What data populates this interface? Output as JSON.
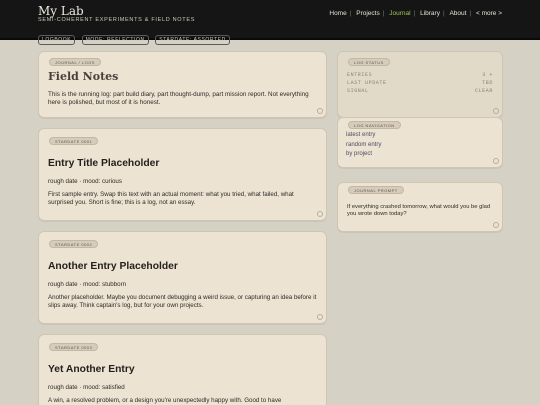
{
  "header": {
    "title": "My Lab",
    "subtitle": "SEMI-COHERENT EXPERIMENTS & FIELD NOTES",
    "nav": [
      "Home",
      "Projects",
      "Journal",
      "Library",
      "About",
      "< more >"
    ],
    "nav_active": "Journal",
    "chips": [
      "LOGBOOK",
      "MODE: REFLECTION",
      "STARDATE: ASSORTED"
    ]
  },
  "intro": {
    "label": "JOURNAL / LOGS",
    "title": "Field Notes",
    "text": "This is the running log: part build diary, part thought-dump, part mission report. Not everything here is polished, but most of it is honest."
  },
  "entries": [
    {
      "stardate": "STARDATE 0001",
      "title": "Entry Title Placeholder",
      "meta": "rough date · mood: curious",
      "body": "First sample entry. Swap this text with an actual moment: what you tried, what failed, what surprised you. Short is fine; this is a log, not an essay."
    },
    {
      "stardate": "STARDATE 0002",
      "title": "Another Entry Placeholder",
      "meta": "rough date · mood: stubborn",
      "body": "Another placeholder. Maybe you document debugging a weird issue, or capturing an idea before it slips away. Think captain's log, but for your own projects."
    },
    {
      "stardate": "STARDATE 0003",
      "title": "Yet Another Entry",
      "meta": "rough date · mood: satisfied",
      "body": "A win, a resolved problem, or a design you're unexpectedly happy with. Good to have"
    }
  ],
  "log_status": {
    "label": "LOG STATUS",
    "rows": [
      {
        "key": "ENTRIES",
        "value": "3 +"
      },
      {
        "key": "LAST UPDATE",
        "value": "TBD"
      },
      {
        "key": "SIGNAL",
        "value": "CLEAR"
      }
    ]
  },
  "log_navigation": {
    "label": "LOG NAVIGATION",
    "links": [
      "latest entry",
      "random entry",
      "by project"
    ]
  },
  "journal_prompt": {
    "label": "JOURNAL PROMPT",
    "text": "If everything crashed tomorrow, what would you be glad you wrote down today?"
  },
  "colors": {
    "background": "#d6d1c5",
    "card": "#ece3d3",
    "header": "#151515",
    "nav_active": "#a3c35c",
    "link": "#4e4a66"
  }
}
